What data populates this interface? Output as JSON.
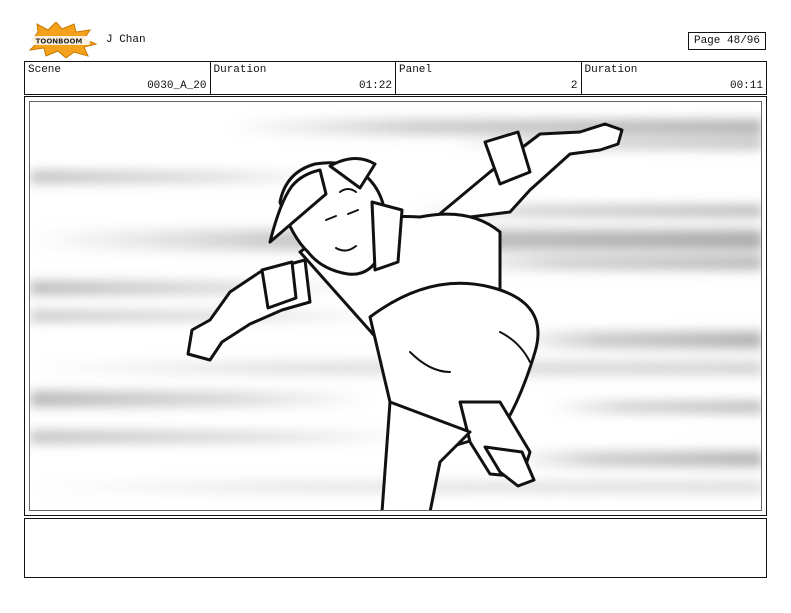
{
  "header": {
    "logo_text": "TOONBOOM",
    "project": "J Chan",
    "page": "Page 48/96"
  },
  "info": {
    "scene_label": "Scene",
    "scene_value": "0030_A_20",
    "duration_label": "Duration",
    "duration_value": "01:22",
    "panel_label": "Panel",
    "panel_value": "2",
    "panel_duration_label": "Duration",
    "panel_duration_value": "00:11"
  },
  "colors": {
    "logo_burst": "#f4a21c",
    "logo_text": "#2a2a2a",
    "speed_lines": "#8a8a8a"
  },
  "notes": {
    "text": ""
  }
}
